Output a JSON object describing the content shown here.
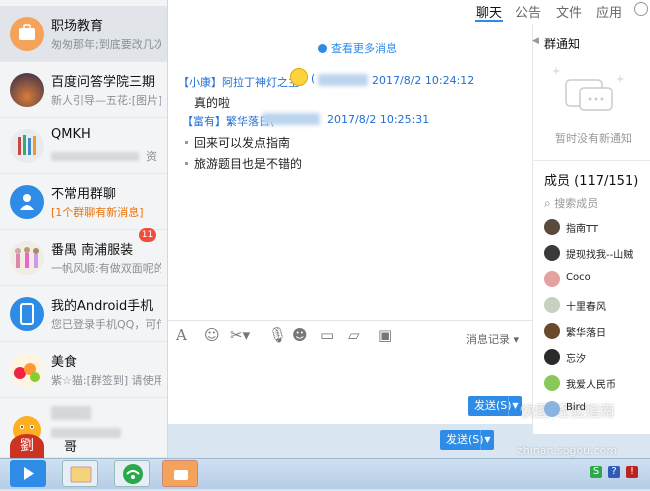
{
  "conversations": [
    {
      "name": "职场教育",
      "preview": "匆匆那年;到底要改几次"
    },
    {
      "name": "百度问答学院三期",
      "preview": "新人引导—五花:[图片]"
    },
    {
      "name": "QMKH",
      "preview": "资"
    },
    {
      "name": "不常用群聊",
      "preview": "[1个群聊有新消息]"
    },
    {
      "name": "番禺 南浦服装",
      "preview": "一帆风顺:有做双面呢的",
      "badge": "11"
    },
    {
      "name": "我的Android手机",
      "preview": "您已登录手机QQ，可传"
    },
    {
      "name": "美食",
      "preview": "紫☆猫:[群签到] 请使用"
    },
    {
      "name": "",
      "preview": ""
    },
    {
      "name": "哥",
      "preview": ""
    }
  ],
  "tabs": [
    "聊天",
    "公告",
    "文件",
    "应用"
  ],
  "chat": {
    "more_messages": "查看更多消息",
    "messages": [
      {
        "sender": "【小康】阿拉丁神灯之主",
        "time": "2017/8/2 10:24:12",
        "lines": [
          "真的啦"
        ]
      },
      {
        "sender": "【富有】繁华落日(",
        "time": "2017/8/2 10:25:31",
        "lines": [
          "回来可以发点指南",
          "旅游题目也是不错的"
        ]
      }
    ]
  },
  "toolbar": {
    "history_label": "消息记录",
    "send_label": "发送(S)",
    "send_label_back": "发送(S)"
  },
  "right_panel": {
    "notice_title": "群通知",
    "notice_empty": "暂时没有新通知",
    "members_label": "成员 (117/151)",
    "member_search": "搜索成员",
    "members": [
      {
        "name": "指南TT",
        "color": "#5a4a3c"
      },
      {
        "name": "提现找我--山贼",
        "color": "#3a3a3a"
      },
      {
        "name": "Coco",
        "color": "#e5a0a0"
      },
      {
        "name": "十里春风",
        "color": "#c8d0c0"
      },
      {
        "name": "繁华落日",
        "color": "#6a4a2a"
      },
      {
        "name": "忘汐",
        "color": "#2a2a2a"
      },
      {
        "name": "我爱人民币",
        "color": "#8ac85a"
      },
      {
        "name": "Bird",
        "color": "#8ab4e0"
      }
    ]
  },
  "watermark": {
    "line1": "快图 经验指南",
    "line2": "zhinan.sogou.com"
  }
}
